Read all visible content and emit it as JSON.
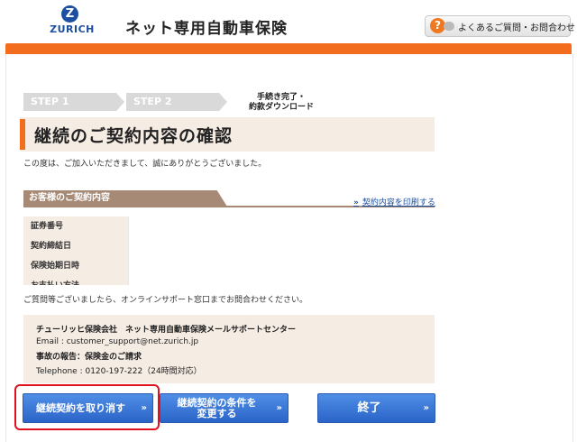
{
  "header": {
    "logo_text": "ZURICH",
    "logo_mark": "Z",
    "site_title": "ネット専用自動車保険",
    "faq_button": "よくあるご質問・お問合わせ"
  },
  "steps": {
    "step1": "STEP 1",
    "step2": "STEP 2",
    "step3_line1": "手続き完了・",
    "step3_line2": "約款ダウンロード"
  },
  "page_title": "継続のご契約内容の確認",
  "thanks_message": "この度は、ご加入いただきまして、誠にありがとうございました。",
  "contract_section": {
    "header": "お客様のご契約内容",
    "print_link": "契約内容を印刷する",
    "rows": [
      {
        "label": "証券番号"
      },
      {
        "label": "契約締結日"
      },
      {
        "label": "保険始期日時"
      },
      {
        "label": "お支払い方法"
      }
    ]
  },
  "inquiry_message": "ご質問等ございましたら、オンラインサポート窓口までお問合わせください。",
  "support": {
    "center": "チューリッヒ保険会社　ネット専用自動車保険メールサポートセンター",
    "email": "Email : customer_support@net.zurich.jp",
    "accident": "事故の報告：保険金のご請求",
    "phone": "Telephone : 0120-197-222（24時間対応）"
  },
  "buttons": {
    "cancel": "継続契約を取り消す",
    "change_line1": "継続契約の条件を",
    "change_line2": "変更する",
    "finish": "終了"
  },
  "colors": {
    "accent": "#f36d1f",
    "brand": "#1d4fa0",
    "button": "#3a77d6",
    "highlight": "#e0101c"
  }
}
